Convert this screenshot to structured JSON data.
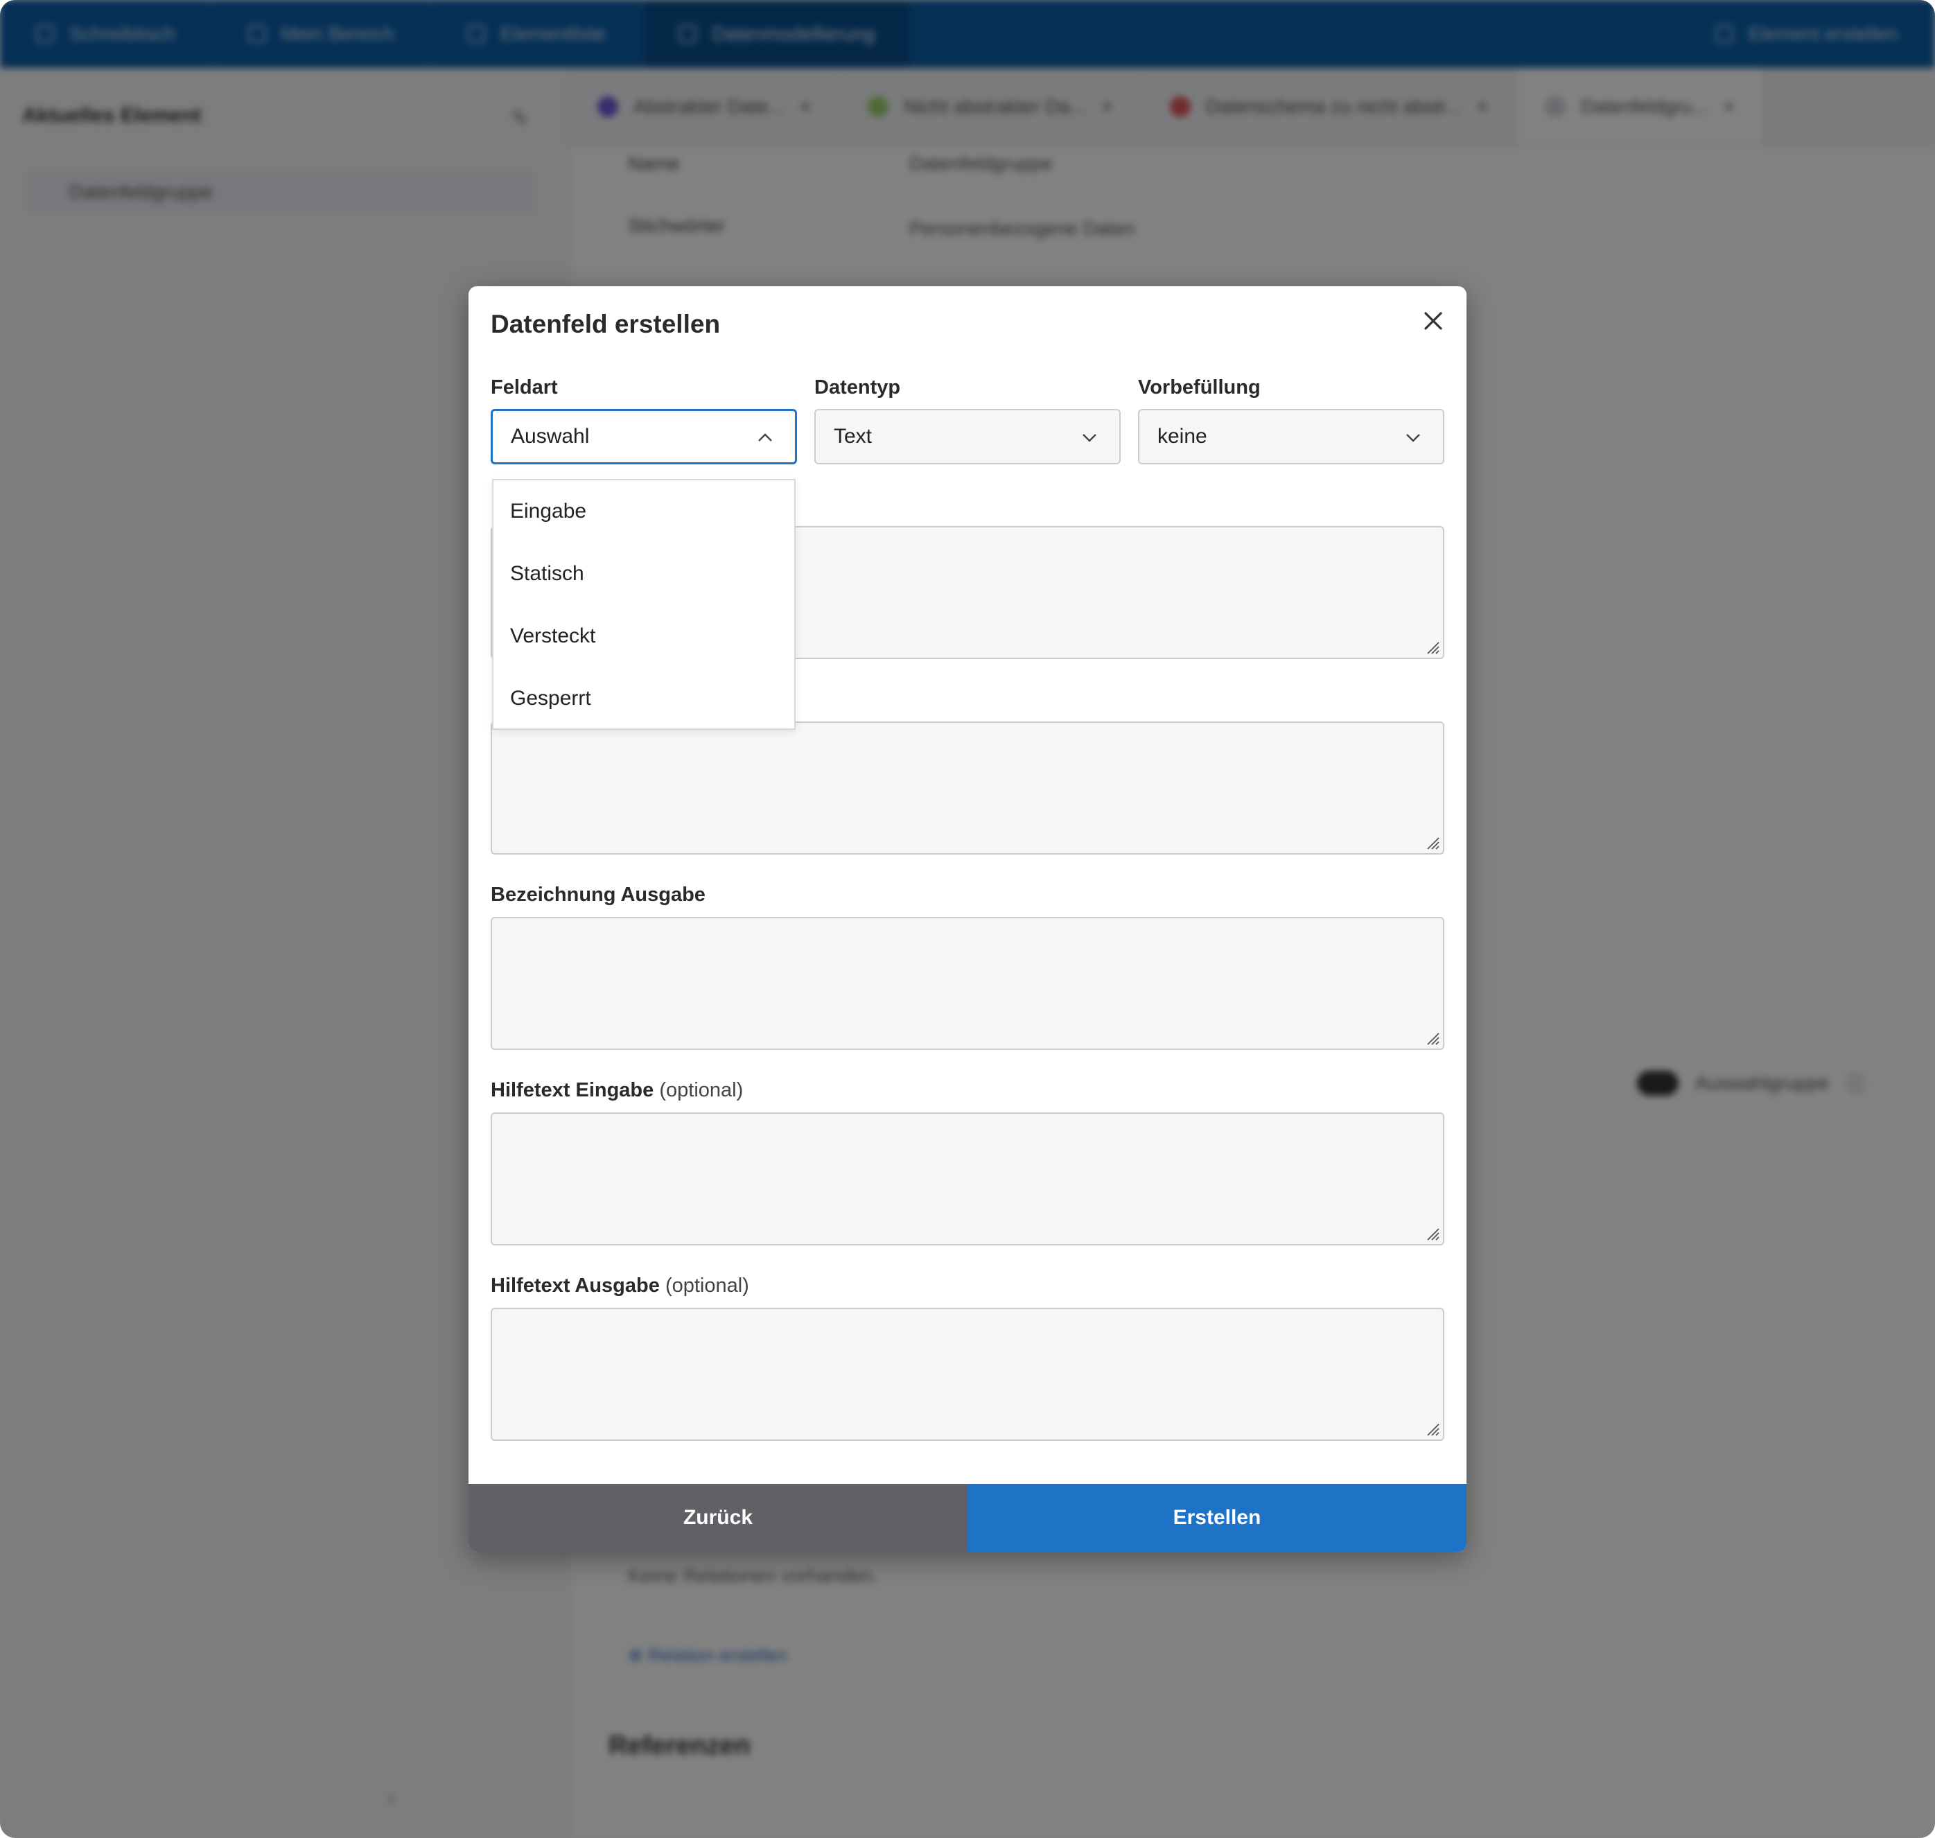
{
  "background": {
    "topbar_tabs": [
      "Schreibtisch",
      "Mein Bereich",
      "Elementliste",
      "Datenmodellierung"
    ],
    "create_element_label": "Element erstellen",
    "sidebar": {
      "heading": "Aktuelles Element",
      "item": "Datenfeldgruppe"
    },
    "doc_tabs": [
      {
        "label": "Abstrakter Date...",
        "color": "#6b5bd6"
      },
      {
        "label": "Nicht abstrakter Da...",
        "color": "#9ccf6a"
      },
      {
        "label": "Datenschema zu nicht abstr...",
        "color": "#e05555"
      },
      {
        "label": "Datenfeldgru...",
        "color": "#cfd3d8"
      }
    ],
    "fields": [
      {
        "label": "Name",
        "value": "Datenfeldgruppe"
      },
      {
        "label": "Stichwörter",
        "value": "Personenbezogene Daten"
      }
    ],
    "toggle_label": "Auswahlgruppe",
    "relations_empty": "Keine Relationen vorhanden.",
    "relation_link": "Relation erstellen",
    "references_heading": "Referenzen"
  },
  "modal": {
    "title": "Datenfeld erstellen",
    "feldart": {
      "label": "Feldart",
      "value": "Auswahl",
      "options": [
        "Eingabe",
        "Statisch",
        "Versteckt",
        "Gesperrt"
      ]
    },
    "datentyp": {
      "label": "Datentyp",
      "value": "Text"
    },
    "vorbefuellung": {
      "label": "Vorbefüllung",
      "value": "keine"
    },
    "bezeichnung_ausgabe": {
      "label": "Bezeichnung Ausgabe"
    },
    "hilfetext_eingabe": {
      "label": "Hilfetext Eingabe",
      "optional": "(optional)"
    },
    "hilfetext_ausgabe": {
      "label": "Hilfetext Ausgabe",
      "optional": "(optional)"
    },
    "back_label": "Zurück",
    "create_label": "Erstellen"
  },
  "colors": {
    "primary": "#1f73c7",
    "back_button": "#5f6164",
    "topbar": "#0d5ea8"
  }
}
